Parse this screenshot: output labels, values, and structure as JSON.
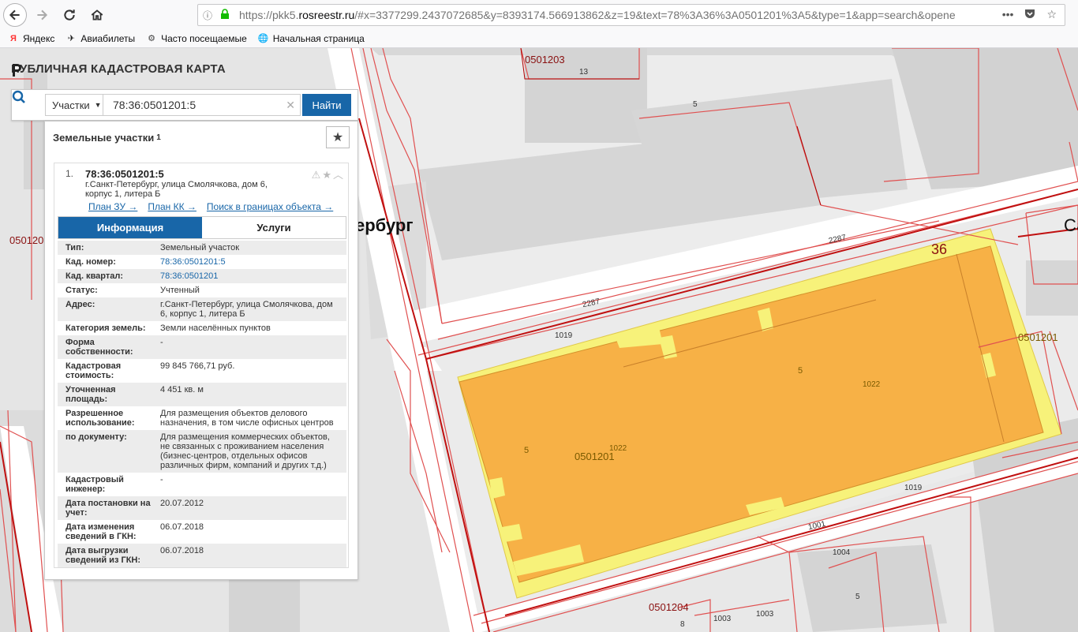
{
  "browser": {
    "url_prefix": "https://pkk5.",
    "url_domain": "rosreestr.ru",
    "url_rest": "/#x=3377299.2437072685&y=8393174.566913862&z=19&text=78%3A36%3A0501201%3A5&type=1&app=search&opene",
    "bookmarks": [
      {
        "label": "Яндекс",
        "icon": "yandex-icon"
      },
      {
        "label": "Авиабилеты",
        "icon": "plane-icon"
      },
      {
        "label": "Часто посещаемые",
        "icon": "gear-icon"
      },
      {
        "label": "Начальная страница",
        "icon": "globe-icon"
      }
    ]
  },
  "app": {
    "title": "ПУБЛИЧНАЯ КАДАСТРОВАЯ КАРТА"
  },
  "search": {
    "category": "Участки",
    "query": "78:36:0501201:5",
    "button": "Найти"
  },
  "panel": {
    "heading": "Земельные участки",
    "count": "1"
  },
  "result": {
    "number": "1.",
    "title": "78:36:0501201:5",
    "address": "г.Санкт-Петербург, улица Смолячкова, дом 6, корпус 1, литера Б",
    "links": [
      "План ЗУ →",
      "План КК →",
      "Поиск в границах объекта →"
    ],
    "tabs": [
      "Информация",
      "Услуги"
    ]
  },
  "info_rows": [
    {
      "key": "Тип:",
      "value": "Земельный участок",
      "link": false
    },
    {
      "key": "Кад. номер:",
      "value": "78:36:0501201:5",
      "link": true
    },
    {
      "key": "Кад. квартал:",
      "value": "78:36:0501201",
      "link": true
    },
    {
      "key": "Статус:",
      "value": "Учтенный",
      "link": false
    },
    {
      "key": "Адрес:",
      "value": "г.Санкт-Петербург, улица Смолячкова, дом 6, корпус 1, литера Б",
      "link": false
    },
    {
      "key": "Категория земель:",
      "value": "Земли населённых пунктов",
      "link": false
    },
    {
      "key": "Форма собственности:",
      "value": "-",
      "link": false
    },
    {
      "key": "Кадастровая стоимость:",
      "value": "99 845 766,71 руб.",
      "link": false
    },
    {
      "key": "Уточненная площадь:",
      "value": "4 451 кв. м",
      "link": false
    },
    {
      "key": "Разрешенное использование:",
      "value": "Для размещения объектов делового назначения, в том числе офисных центров",
      "link": false
    },
    {
      "key": "по документу:",
      "value": "Для размещения коммерческих объектов, не связанных с проживанием населения (бизнес-центров, отдельных офисов различных фирм, компаний и других т.д.)",
      "link": false
    },
    {
      "key": "Кадастровый инженер:",
      "value": "-",
      "link": false
    },
    {
      "key": "Дата постановки на учет:",
      "value": "20.07.2012",
      "link": false
    },
    {
      "key": "Дата изменения сведений в ГКН:",
      "value": "06.07.2018",
      "link": false
    },
    {
      "key": "Дата выгрузки сведений из ГКН:",
      "value": "06.07.2018",
      "link": false
    }
  ],
  "map_labels": {
    "q0501203": "0501203",
    "n13": "13",
    "n5a": "5",
    "street": "ербург",
    "n36": "36",
    "sa": "Са",
    "n2287a": "2287",
    "n2287b": "2287",
    "n1019a": "1019",
    "q0501201r": "0501201",
    "n5b": "5",
    "n1022a": "1022",
    "n5c": "5",
    "q0501201c": "0501201",
    "n1022b": "1022",
    "n1019b": "1019",
    "n1001": "1001",
    "n1004": "1004",
    "q0501204": "0501204",
    "n1003a": "1003",
    "n1003b": "1003",
    "n8": "8",
    "n5d": "5",
    "q0501201l": "050120"
  }
}
